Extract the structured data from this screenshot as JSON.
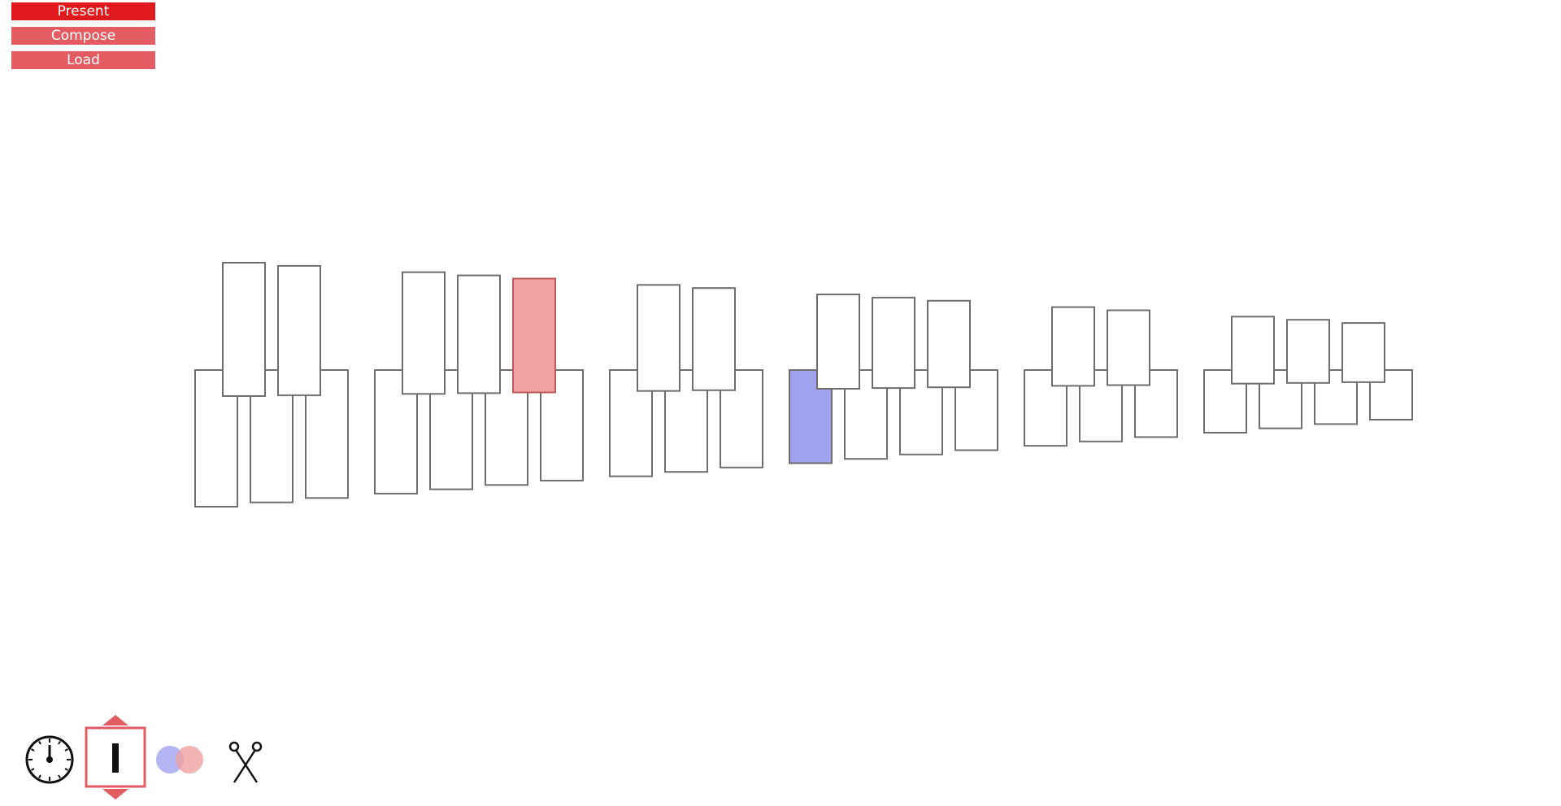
{
  "menu": {
    "items": [
      {
        "label": "Present",
        "state": "active"
      },
      {
        "label": "Compose",
        "state": "inactive"
      },
      {
        "label": "Load",
        "state": "inactive"
      }
    ]
  },
  "keyboard": {
    "octaves": 6,
    "white_keys_per_octave": [
      3,
      4,
      3,
      4,
      3,
      4
    ],
    "highlighted_keys": [
      {
        "row": "upper",
        "octave": 1,
        "index": 2,
        "color": "#f0a1a1"
      },
      {
        "row": "lower",
        "octave": 3,
        "index": 0,
        "color": "#a1a2f0"
      }
    ]
  },
  "toolbar": {
    "tools": [
      {
        "icon": "clock-icon"
      },
      {
        "icon": "note-length-icon",
        "selected": true
      },
      {
        "icon": "overlap-circles-icon"
      },
      {
        "icon": "scissors-icon"
      }
    ]
  },
  "colors": {
    "accent": "#e0191c",
    "accent_light": "#e35c61",
    "key_stroke": "#6e6e6e",
    "highlight_red": "#f0a1a1",
    "highlight_blue": "#a1a2f0"
  }
}
